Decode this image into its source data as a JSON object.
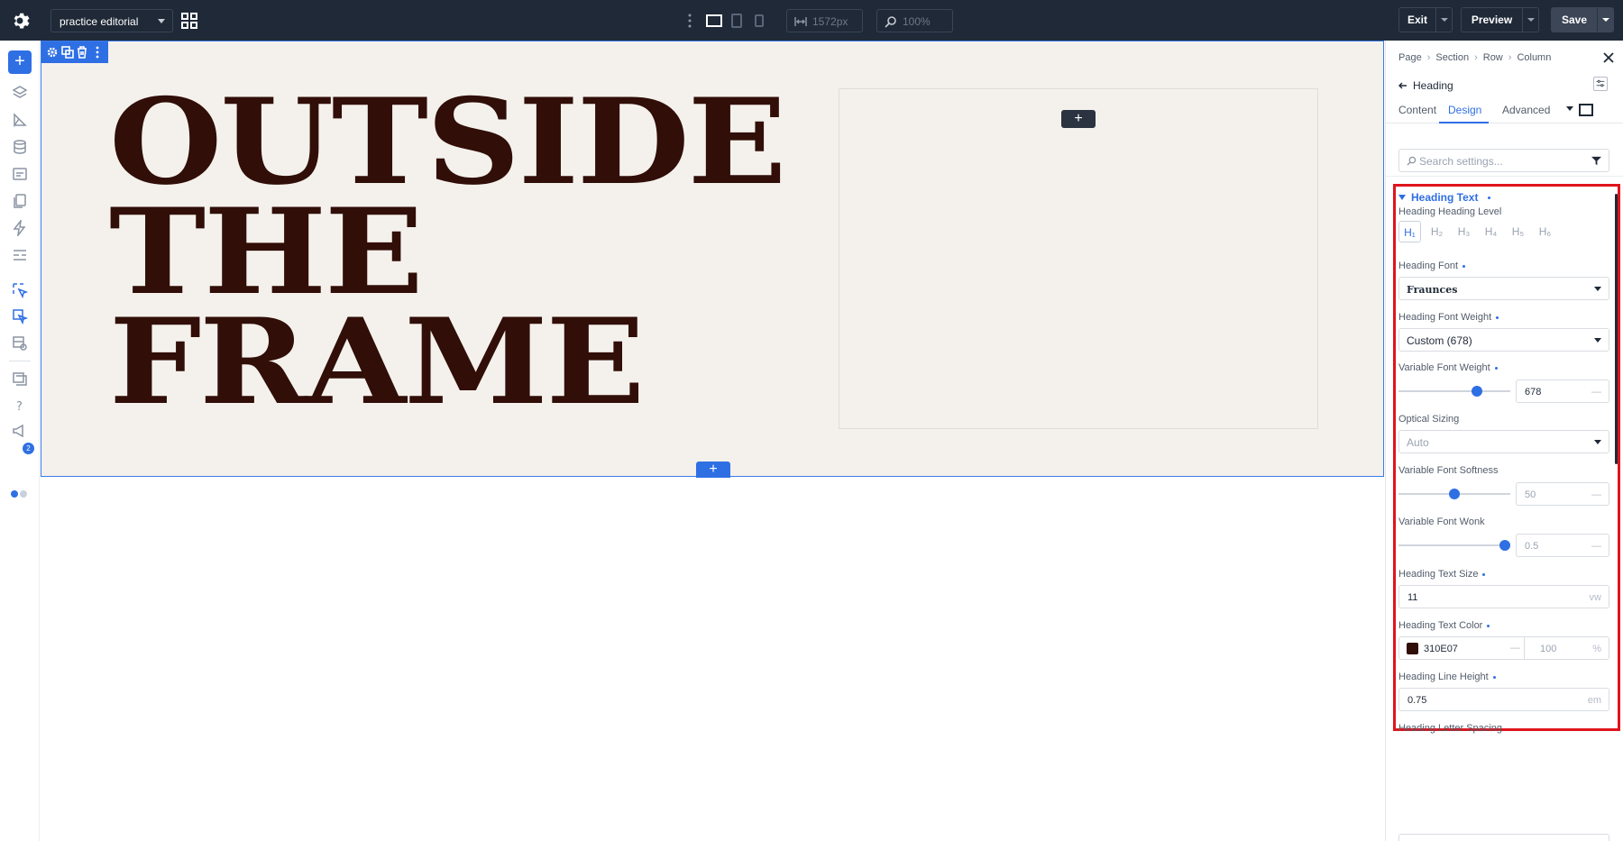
{
  "topbar": {
    "project": "practice editorial",
    "width_value": "1572px",
    "zoom_value": "100%",
    "exit_label": "Exit",
    "preview_label": "Preview",
    "save_label": "Save"
  },
  "leftbar": {
    "notification_count": "2"
  },
  "canvas": {
    "headline": [
      "OUTSIDE",
      "THE",
      "FRAME"
    ],
    "heading_color": "#310E07"
  },
  "panel": {
    "breadcrumb": [
      "Page",
      "Section",
      "Row",
      "Column"
    ],
    "element_title": "Heading",
    "tabs": [
      "Content",
      "Design",
      "Advanced"
    ],
    "active_tab": "Design",
    "search_placeholder": "Search settings...",
    "group_title": "Heading Text",
    "heading_level": {
      "label": "Heading Heading Level",
      "options": [
        "H₁",
        "H₂",
        "H₃",
        "H₄",
        "H₅",
        "H₆"
      ],
      "selected": "H₁"
    },
    "font": {
      "label": "Heading Font",
      "value": "Fraunces"
    },
    "font_weight": {
      "label": "Heading Font Weight",
      "value": "Custom (678)"
    },
    "variable_weight": {
      "label": "Variable Font Weight",
      "value": "678",
      "unit": "—",
      "slider_pct": 0.7
    },
    "optical_sizing": {
      "label": "Optical Sizing",
      "value": "Auto"
    },
    "softness": {
      "label": "Variable Font Softness",
      "value": "50",
      "unit": "—",
      "slider_pct": 0.5
    },
    "wonk": {
      "label": "Variable Font Wonk",
      "value": "0.5",
      "unit": "—",
      "slider_pct": 0.95
    },
    "text_size": {
      "label": "Heading Text Size",
      "value": "11",
      "unit": "vw"
    },
    "text_color": {
      "label": "Heading Text Color",
      "hex": "310E07",
      "dash": "—",
      "opacity": "100",
      "pct": "%"
    },
    "line_height": {
      "label": "Heading Line Height",
      "value": "0.75",
      "unit": "em"
    },
    "letter_spacing": {
      "label": "Heading Letter Spacing"
    }
  },
  "colors": {
    "accent": "#2f6fe4",
    "topbar": "#1f2937",
    "highlight": "#e0141c",
    "canvas_bg": "#f4f1ec"
  }
}
